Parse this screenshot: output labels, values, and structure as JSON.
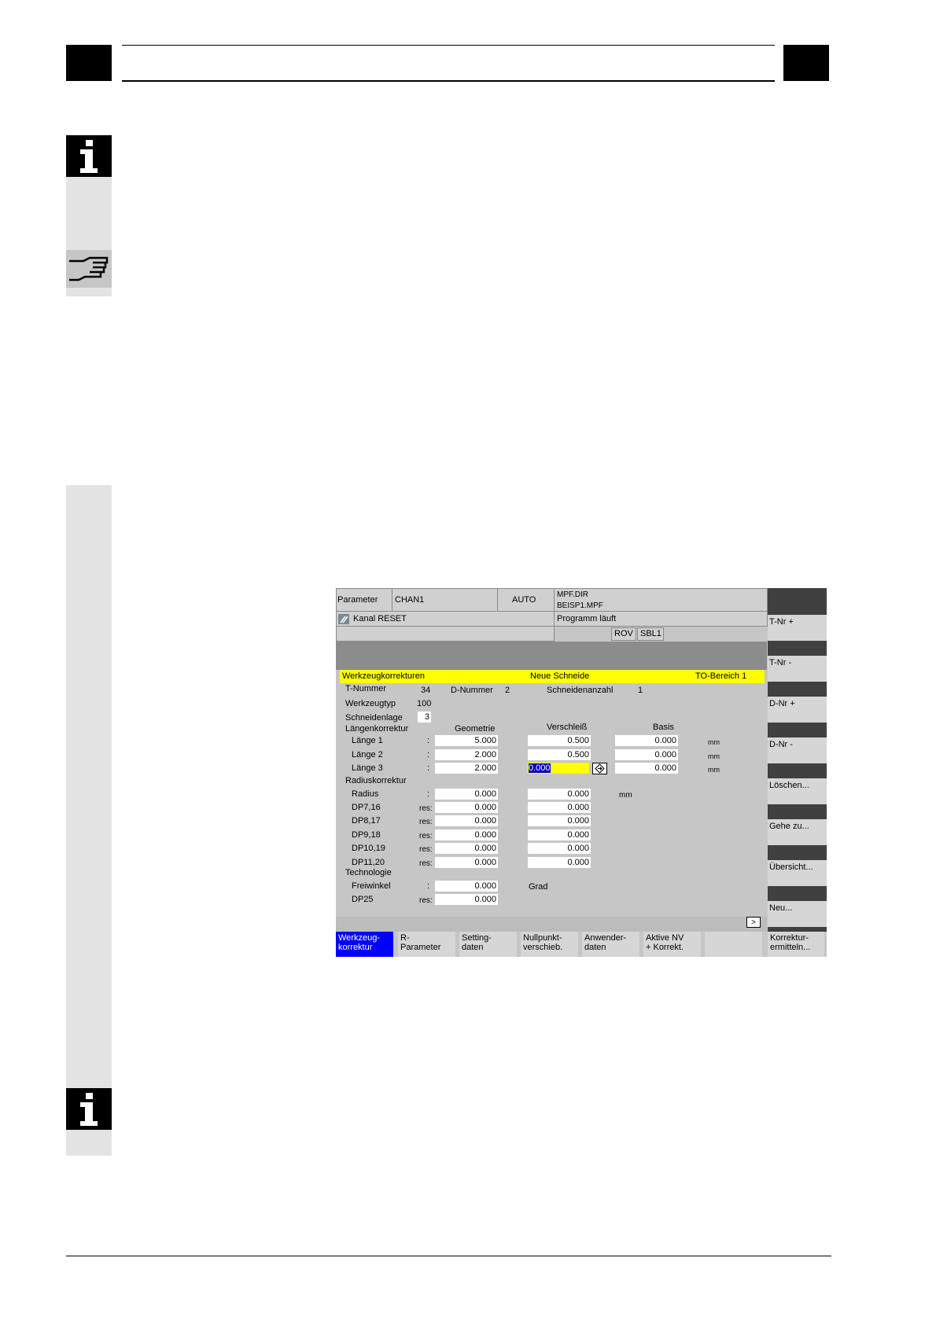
{
  "hmi": {
    "status": {
      "area": "Parameter",
      "channel": "CHAN1",
      "mode": "AUTO",
      "program_dir": "MPF.DIR",
      "program_file": "BEISP1.MPF",
      "channel_status": "Kanal RESET",
      "program_status": "Programm läuft",
      "indicator_rov": "ROV",
      "indicator_sbl": "SBL1"
    },
    "window": {
      "title": "Werkzeugkorrekturen",
      "subtitle": "Neue Schneide",
      "to_area": "TO-Bereich  1",
      "t_number_label": "T-Nummer",
      "t_number": "34",
      "d_number_label": "D-Nummer",
      "d_number": "2",
      "edges_label": "Schneidenanzahl",
      "edges": "1",
      "tool_type_label": "Werkzeugtyp",
      "tool_type": "100",
      "edge_position_label": "Schneidenlage",
      "edge_position": "3",
      "length_section": "Längenkorrektur",
      "col_geometry": "Geometrie",
      "col_wear": "Verschleiß",
      "col_base": "Basis",
      "lengths": [
        {
          "label": "Länge  1",
          "sep": ":",
          "geometry": "5.000",
          "wear": "0.500",
          "base": "0.000",
          "unit": "mm"
        },
        {
          "label": "Länge  2",
          "sep": ":",
          "geometry": "2.000",
          "wear": "0.500",
          "base": "0.000",
          "unit": "mm"
        },
        {
          "label": "Länge  3",
          "sep": ":",
          "geometry": "2.000",
          "wear": "0.000",
          "base": "0.000",
          "unit": "mm"
        }
      ],
      "radius_section": "Radiuskorrektur",
      "radius_rows": [
        {
          "label": "Radius",
          "sep": ":",
          "geometry": "0.000",
          "wear": "0.000",
          "unit": "mm"
        },
        {
          "label": "DP7,16",
          "sep": "res:",
          "geometry": "0.000",
          "wear": "0.000"
        },
        {
          "label": "DP8,17",
          "sep": "res:",
          "geometry": "0.000",
          "wear": "0.000"
        },
        {
          "label": "DP9,18",
          "sep": "res:",
          "geometry": "0.000",
          "wear": "0.000"
        },
        {
          "label": "DP10,19",
          "sep": "res:",
          "geometry": "0.000",
          "wear": "0.000"
        },
        {
          "label": "DP11,20",
          "sep": "res:",
          "geometry": "0.000",
          "wear": "0.000"
        }
      ],
      "tech_section": "Technologie",
      "tech_rows": [
        {
          "label": "Freiwinkel",
          "sep": ":",
          "value": "0.000",
          "unit": "Grad"
        },
        {
          "label": "DP25",
          "sep": "res:",
          "value": "0.000"
        }
      ]
    },
    "vertical_softkeys": [
      "T-Nr +",
      "T-Nr -",
      "D-Nr +",
      "D-Nr -",
      "Löschen...",
      "Gehe zu...",
      "Übersicht...",
      "Neu..."
    ],
    "horizontal_softkeys": [
      {
        "line1": "Werkzeug-",
        "line2": "korrektur"
      },
      {
        "line1": "R-",
        "line2": "Parameter"
      },
      {
        "line1": "Setting-",
        "line2": "daten"
      },
      {
        "line1": "Nullpunkt-",
        "line2": "verschieb."
      },
      {
        "line1": "Anwender-",
        "line2": "daten"
      },
      {
        "line1": "Aktive NV",
        "line2": "+ Korrekt."
      },
      {
        "line1": "",
        "line2": ""
      },
      {
        "line1": "Korrektur-",
        "line2": "ermitteln..."
      }
    ],
    "more_arrow": ">",
    "colors": {
      "title_bar": "#ffff00",
      "active_softkey": "#0000ff",
      "focus_field": "#ffff00"
    }
  }
}
